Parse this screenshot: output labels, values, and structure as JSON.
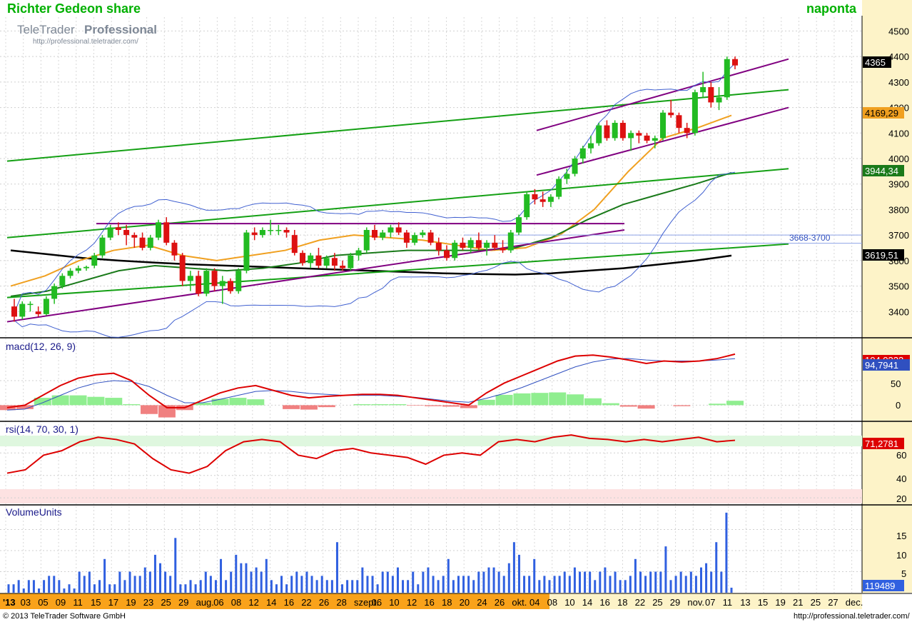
{
  "header": {
    "title": "Richter Gedeon share",
    "period": "naponta",
    "logo_main": "TeleTrader",
    "logo_bold": "Professional",
    "logo_url": "http://professional.teletrader.com/"
  },
  "footer": {
    "copyright": "© 2013 TeleTrader Software GmbH",
    "url": "http://professional.teletrader.com/"
  },
  "colors": {
    "title": "#00b000",
    "up_candle": "#22bb22",
    "down_candle": "#dd1111",
    "trend_purple": "#800080",
    "trend_green": "#14a014",
    "ma_black": "#000000",
    "ma_orange": "#f0a020",
    "ma_darkgreen": "#1a7a1a",
    "bollinger": "#4060d0",
    "macd_line": "#dd0000",
    "macd_signal": "#3050c0",
    "rsi_line": "#dd0000",
    "volume": "#3060e0",
    "axis_bg": "#fdf3c8",
    "date_axis_bg": "#f9a21a"
  },
  "price_axis": {
    "ticks": [
      "4500",
      "4400",
      "4300",
      "4200",
      "4100",
      "4000",
      "3900",
      "3800",
      "3700",
      "3600",
      "3500",
      "3400"
    ]
  },
  "badges": {
    "last_close": "4365",
    "ma_orange_value": "4169,29",
    "ma_darkgreen_value": "3944,34",
    "ma_black_value": "3619,51",
    "zone_label": "3668-3700"
  },
  "macd_panel": {
    "label": "macd(12, 26, 9)",
    "ticks": [
      "50",
      "0"
    ],
    "value_signal": "94,7941",
    "value_macd_partial": "104,0323"
  },
  "rsi_panel": {
    "label": "rsi(14, 70, 30, 1)",
    "ticks": [
      "60",
      "40",
      "20"
    ],
    "value": "71,2781"
  },
  "volume_panel": {
    "label": "VolumeUnits",
    "ticks": [
      "15",
      "10",
      "5"
    ],
    "value": "119489"
  },
  "date_axis": {
    "labels": [
      "'13",
      "03",
      "05",
      "09",
      "11",
      "15",
      "17",
      "19",
      "23",
      "25",
      "29",
      "aug.",
      "06",
      "08",
      "12",
      "14",
      "16",
      "22",
      "26",
      "28",
      "szept.",
      "06",
      "10",
      "12",
      "16",
      "18",
      "20",
      "24",
      "26",
      "okt.",
      "04",
      "08",
      "10",
      "14",
      "16",
      "18",
      "22",
      "25",
      "29",
      "nov.",
      "07",
      "11",
      "13",
      "15",
      "19",
      "21",
      "25",
      "27",
      "dec."
    ]
  },
  "chart_data": [
    {
      "type": "candlestick",
      "title": "Richter Gedeon share",
      "ylim": [
        3300,
        4560
      ],
      "grid": true,
      "x": [
        "'13",
        "03",
        "05",
        "09",
        "11",
        "15",
        "17",
        "19",
        "23",
        "25",
        "29",
        "aug.",
        "06",
        "08",
        "12",
        "14",
        "16",
        "22",
        "26",
        "28",
        "szept.",
        "06",
        "10",
        "12",
        "16",
        "18",
        "20",
        "24",
        "26",
        "okt.",
        "04",
        "08",
        "10",
        "14",
        "16",
        "18",
        "22",
        "25",
        "29",
        "nov.",
        "07",
        "11"
      ],
      "candles": [
        [
          3420,
          3450,
          3360,
          3380
        ],
        [
          3380,
          3440,
          3370,
          3430
        ],
        [
          3430,
          3440,
          3400,
          3430
        ],
        [
          3400,
          3420,
          3380,
          3390
        ],
        [
          3390,
          3460,
          3385,
          3450
        ],
        [
          3450,
          3510,
          3430,
          3500
        ],
        [
          3500,
          3550,
          3490,
          3540
        ],
        [
          3540,
          3570,
          3530,
          3560
        ],
        [
          3560,
          3580,
          3550,
          3570
        ],
        [
          3570,
          3580,
          3560,
          3575
        ],
        [
          3580,
          3630,
          3570,
          3620
        ],
        [
          3620,
          3700,
          3610,
          3690
        ],
        [
          3690,
          3740,
          3680,
          3730
        ],
        [
          3730,
          3750,
          3700,
          3720
        ],
        [
          3720,
          3740,
          3660,
          3700
        ],
        [
          3700,
          3710,
          3650,
          3690
        ],
        [
          3690,
          3710,
          3640,
          3650
        ],
        [
          3650,
          3700,
          3640,
          3690
        ],
        [
          3690,
          3760,
          3680,
          3750
        ],
        [
          3750,
          3770,
          3660,
          3670
        ],
        [
          3670,
          3680,
          3600,
          3620
        ],
        [
          3620,
          3630,
          3500,
          3520
        ],
        [
          3520,
          3560,
          3480,
          3540
        ],
        [
          3540,
          3560,
          3460,
          3470
        ],
        [
          3470,
          3570,
          3460,
          3560
        ],
        [
          3560,
          3570,
          3480,
          3500
        ],
        [
          3500,
          3540,
          3430,
          3520
        ],
        [
          3520,
          3530,
          3470,
          3480
        ],
        [
          3480,
          3570,
          3470,
          3560
        ],
        [
          3560,
          3720,
          3550,
          3710
        ],
        [
          3710,
          3730,
          3680,
          3700
        ],
        [
          3700,
          3730,
          3690,
          3720
        ],
        [
          3720,
          3760,
          3700,
          3720
        ],
        [
          3720,
          3740,
          3700,
          3720
        ],
        [
          3720,
          3730,
          3690,
          3710
        ],
        [
          3700,
          3720,
          3620,
          3630
        ],
        [
          3630,
          3640,
          3580,
          3590
        ],
        [
          3590,
          3630,
          3570,
          3620
        ],
        [
          3620,
          3650,
          3570,
          3580
        ],
        [
          3580,
          3620,
          3570,
          3610
        ],
        [
          3610,
          3630,
          3560,
          3580
        ],
        [
          3580,
          3600,
          3560,
          3570
        ],
        [
          3570,
          3630,
          3560,
          3620
        ],
        [
          3620,
          3650,
          3600,
          3640
        ],
        [
          3640,
          3730,
          3630,
          3720
        ],
        [
          3720,
          3740,
          3680,
          3690
        ],
        [
          3690,
          3720,
          3680,
          3710
        ],
        [
          3710,
          3740,
          3690,
          3730
        ],
        [
          3730,
          3750,
          3700,
          3710
        ],
        [
          3710,
          3720,
          3650,
          3670
        ],
        [
          3670,
          3710,
          3660,
          3700
        ],
        [
          3700,
          3720,
          3690,
          3710
        ],
        [
          3710,
          3720,
          3660,
          3670
        ],
        [
          3670,
          3690,
          3620,
          3640
        ],
        [
          3640,
          3660,
          3600,
          3610
        ],
        [
          3610,
          3680,
          3600,
          3670
        ],
        [
          3670,
          3690,
          3640,
          3650
        ],
        [
          3650,
          3690,
          3630,
          3680
        ],
        [
          3680,
          3710,
          3640,
          3650
        ],
        [
          3650,
          3680,
          3620,
          3670
        ],
        [
          3670,
          3700,
          3640,
          3650
        ],
        [
          3650,
          3680,
          3630,
          3640
        ],
        [
          3640,
          3720,
          3630,
          3710
        ],
        [
          3710,
          3780,
          3700,
          3770
        ],
        [
          3770,
          3870,
          3760,
          3860
        ],
        [
          3860,
          3880,
          3820,
          3840
        ],
        [
          3840,
          3870,
          3810,
          3830
        ],
        [
          3830,
          3860,
          3810,
          3850
        ],
        [
          3850,
          3930,
          3840,
          3920
        ],
        [
          3920,
          3960,
          3900,
          3940
        ],
        [
          3940,
          4010,
          3930,
          4000
        ],
        [
          4000,
          4050,
          3980,
          4040
        ],
        [
          4040,
          4090,
          4020,
          4060
        ],
        [
          4060,
          4140,
          4050,
          4130
        ],
        [
          4130,
          4150,
          4070,
          4080
        ],
        [
          4080,
          4150,
          4070,
          4140
        ],
        [
          4140,
          4150,
          4070,
          4080
        ],
        [
          4080,
          4110,
          4030,
          4100
        ],
        [
          4100,
          4110,
          4060,
          4090
        ],
        [
          4090,
          4100,
          4060,
          4070
        ],
        [
          4070,
          4090,
          4040,
          4080
        ],
        [
          4080,
          4190,
          4070,
          4180
        ],
        [
          4180,
          4230,
          4160,
          4170
        ],
        [
          4170,
          4180,
          4100,
          4120
        ],
        [
          4120,
          4140,
          4080,
          4100
        ],
        [
          4100,
          4270,
          4090,
          4260
        ],
        [
          4260,
          4340,
          4240,
          4280
        ],
        [
          4280,
          4300,
          4200,
          4220
        ],
        [
          4220,
          4280,
          4190,
          4240
        ],
        [
          4240,
          4400,
          4230,
          4390
        ],
        [
          4390,
          4400,
          4350,
          4365
        ]
      ],
      "overlays": [
        {
          "name": "MA black",
          "values": [
            3640,
            3625,
            3610,
            3600,
            3592,
            3585,
            3580,
            3575,
            3570,
            3565,
            3560,
            3555,
            3550,
            3547,
            3545,
            3550,
            3560,
            3570,
            3585,
            3600,
            3619.51
          ]
        },
        {
          "name": "MA orange",
          "values": [
            3500,
            3540,
            3600,
            3640,
            3660,
            3620,
            3600,
            3620,
            3640,
            3680,
            3700,
            3690,
            3680,
            3660,
            3640,
            3650,
            3700,
            3800,
            3950,
            4080,
            4120,
            4169.29
          ]
        },
        {
          "name": "MA dark green",
          "values": [
            3460,
            3480,
            3520,
            3560,
            3580,
            3570,
            3560,
            3570,
            3590,
            3620,
            3630,
            3640,
            3640,
            3640,
            3650,
            3690,
            3760,
            3820,
            3860,
            3900,
            3944.34
          ]
        }
      ],
      "horizontal_zone": {
        "label": "3668-3700",
        "from": 3668,
        "to": 3700
      },
      "last_value": 4365
    },
    {
      "type": "line",
      "title": "macd(12, 26, 9)",
      "ylim": [
        -30,
        130
      ],
      "series": [
        {
          "name": "macd",
          "values": [
            -5,
            0,
            20,
            40,
            55,
            62,
            65,
            50,
            20,
            -5,
            -5,
            10,
            25,
            35,
            40,
            30,
            20,
            15,
            18,
            20,
            22,
            22,
            20,
            15,
            10,
            5,
            0,
            25,
            45,
            60,
            75,
            90,
            100,
            102,
            98,
            92,
            85,
            90,
            88,
            90,
            95,
            104.03
          ]
        },
        {
          "name": "signal",
          "values": [
            -10,
            -8,
            5,
            20,
            35,
            45,
            50,
            48,
            38,
            20,
            5,
            5,
            12,
            20,
            28,
            30,
            28,
            24,
            22,
            20,
            20,
            20,
            18,
            16,
            12,
            8,
            6,
            14,
            24,
            36,
            50,
            64,
            78,
            88,
            94,
            95,
            92,
            90,
            90,
            90,
            92,
            94.79
          ]
        },
        {
          "name": "histogram",
          "values": [
            -10,
            -8,
            15,
            20,
            20,
            17,
            15,
            2,
            -18,
            -25,
            -10,
            5,
            13,
            15,
            12,
            0,
            -8,
            -9,
            -4,
            0,
            2,
            2,
            2,
            -1,
            -2,
            -3,
            -6,
            11,
            21,
            24,
            25,
            26,
            22,
            14,
            4,
            -3,
            -7,
            0,
            -2,
            0,
            3,
            9
          ]
        }
      ]
    },
    {
      "type": "line",
      "title": "rsi(14, 70, 30, 1)",
      "ylim": [
        15,
        85
      ],
      "series": [
        {
          "name": "rsi",
          "values": [
            42,
            45,
            58,
            62,
            70,
            74,
            72,
            68,
            55,
            45,
            42,
            48,
            62,
            70,
            72,
            70,
            58,
            55,
            62,
            64,
            60,
            58,
            56,
            50,
            58,
            60,
            58,
            70,
            72,
            70,
            74,
            76,
            73,
            72,
            70,
            72,
            70,
            72,
            74,
            70,
            71.28
          ]
        }
      ],
      "bands": {
        "upper": 70,
        "lower": 30
      }
    },
    {
      "type": "bar",
      "title": "VolumeUnits",
      "ylim": [
        0,
        20
      ],
      "values": [
        2,
        2,
        3,
        1,
        3,
        3,
        1,
        3,
        4,
        4,
        3,
        1,
        2,
        1,
        5,
        4,
        5,
        2,
        3,
        8,
        2,
        2,
        5,
        3,
        5,
        4,
        4,
        6,
        5,
        9,
        7,
        5,
        4,
        13,
        2,
        2,
        3,
        2,
        3,
        5,
        4,
        3,
        8,
        3,
        5,
        9,
        7,
        7,
        5,
        6,
        5,
        8,
        3,
        2,
        4,
        2,
        4,
        5,
        4,
        5,
        4,
        3,
        4,
        3,
        3,
        12,
        2,
        3,
        3,
        3,
        6,
        4,
        4,
        2,
        5,
        5,
        4,
        6,
        3,
        3,
        5,
        2,
        5,
        6,
        4,
        3,
        4,
        8,
        3,
        4,
        4,
        4,
        3,
        5,
        5,
        6,
        6,
        5,
        4,
        7,
        12,
        9,
        4,
        4,
        8,
        3,
        4,
        3,
        4,
        4,
        5,
        4,
        6,
        5,
        5,
        5,
        3,
        5,
        6,
        4,
        5,
        3,
        3,
        4,
        8,
        5,
        4,
        5,
        5,
        5,
        11,
        3,
        4,
        5,
        4,
        5,
        4,
        6,
        7,
        5,
        12,
        5,
        19,
        1.19489
      ],
      "last_value": 119489
    }
  ]
}
